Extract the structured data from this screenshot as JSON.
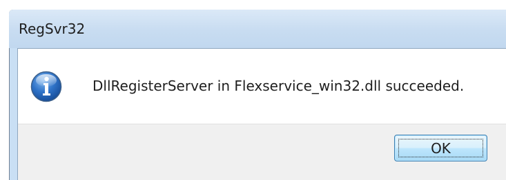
{
  "window": {
    "title": "RegSvr32"
  },
  "dialog": {
    "icon": "information-icon",
    "message": "DllRegisterServer in Flexservice_win32.dll succeeded.",
    "ok_label": "OK"
  },
  "colors": {
    "titlebar": "#c8dcf1",
    "button_area": "#f0f0f0",
    "icon_blue": "#1f5fae"
  }
}
